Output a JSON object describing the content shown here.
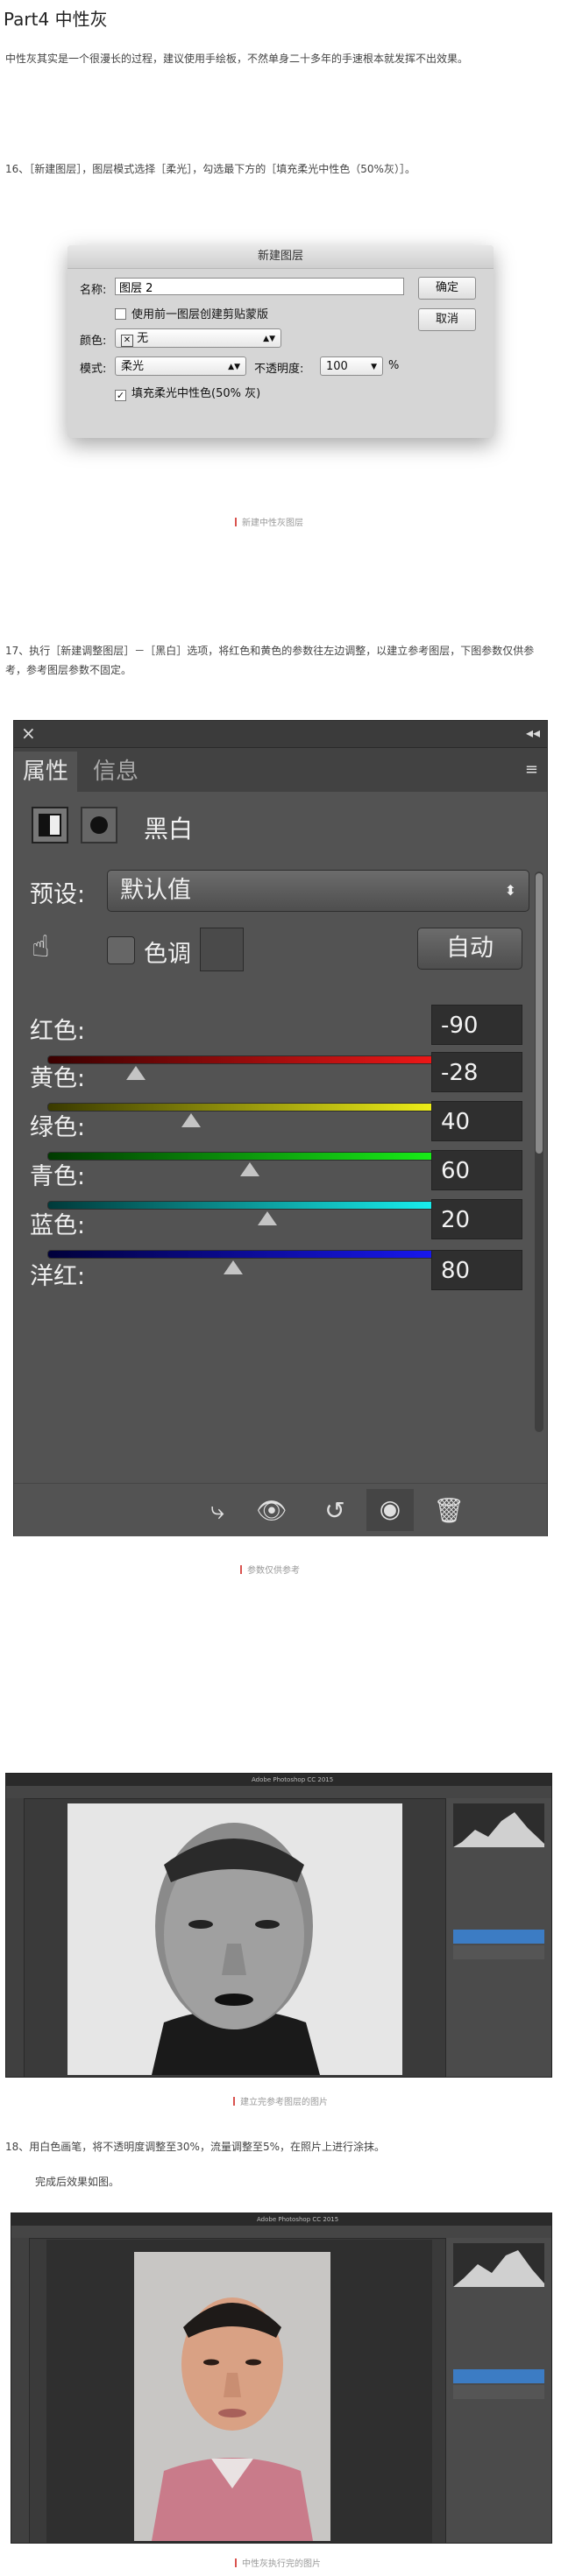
{
  "heading": "Part4 中性灰",
  "intro": "中性灰其实是一个很漫长的过程，建议使用手绘板，不然单身二十多年的手速根本就发挥不出效果。",
  "step16": "16、［新建图层］，图层模式选择［柔光］，勾选最下方的［填充柔光中性色（50%灰）］。",
  "dialog": {
    "title": "新建图层",
    "name_label": "名称:",
    "name_value": "图层 2",
    "ok": "确定",
    "cancel": "取消",
    "clip_label": "使用前一图层创建剪贴蒙版",
    "color_label": "颜色:",
    "color_value": "无",
    "mode_label": "模式:",
    "mode_value": "柔光",
    "opacity_label": "不透明度:",
    "opacity_value": "100",
    "opacity_unit": "%",
    "fill_label": "填充柔光中性色(50% 灰)"
  },
  "caption1": "新建中性灰图层",
  "step17": "17、执行［新建调整图层］－［黑白］选项，将红色和黄色的参数往左边调整，以建立参考图层，下图参数仅供参考，参考图层参数不固定。",
  "props": {
    "tab_active": "属性",
    "tab_inactive": "信息",
    "title": "黑白",
    "preset_label": "预设:",
    "preset_value": "默认值",
    "tint_label": "色调",
    "auto": "自动",
    "sliders": [
      {
        "label": "红色:",
        "value": "-90",
        "pos": 0.21,
        "colors": [
          "#3a0000",
          "#ff1a1a"
        ]
      },
      {
        "label": "黄色:",
        "value": "-28",
        "pos": 0.34,
        "colors": [
          "#3a3a00",
          "#ffff1a"
        ]
      },
      {
        "label": "绿色:",
        "value": "40",
        "pos": 0.48,
        "colors": [
          "#003a00",
          "#1aff1a"
        ]
      },
      {
        "label": "青色:",
        "value": "60",
        "pos": 0.52,
        "colors": [
          "#003a3a",
          "#1affff"
        ]
      },
      {
        "label": "蓝色:",
        "value": "20",
        "pos": 0.44,
        "colors": [
          "#00003a",
          "#1a1aff"
        ]
      },
      {
        "label": "洋红:",
        "value": "80"
      }
    ]
  },
  "caption2": "参数仅供参考",
  "caption3": "建立完参考图层的图片",
  "step18": "18、用白色画笔，将不透明度调整至30%，流量调整至5%，在照片上进行涂抹。",
  "step18b": "完成后效果如图。",
  "caption4": "中性灰执行完的图片",
  "shot1": {
    "title": "Adobe Photoshop CC 2015"
  },
  "shot2": {
    "title": "Adobe Photoshop CC 2015"
  }
}
